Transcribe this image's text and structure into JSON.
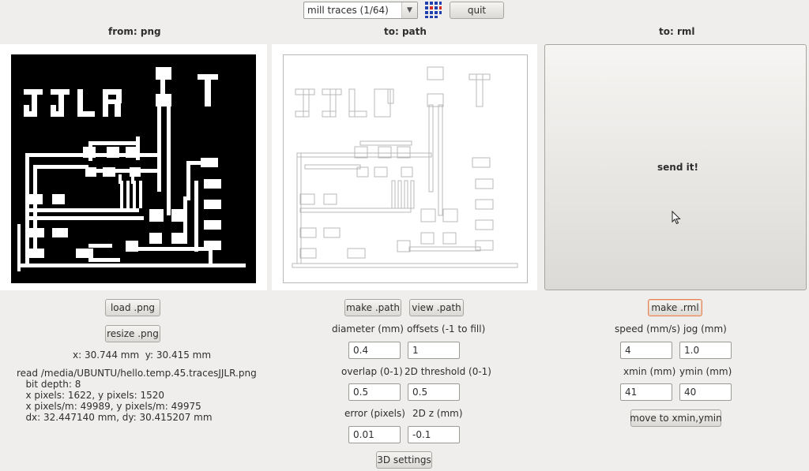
{
  "toolbar": {
    "process_select_value": "mill traces (1/64)",
    "quit_label": "quit",
    "logo_icon": "fab-dots-icon"
  },
  "columns": {
    "from_header": "from: png",
    "to_path_header": "to: path",
    "to_rml_header": "to: rml"
  },
  "png_panel": {
    "load_label": "load .png",
    "resize_label": "resize .png",
    "cursor_readout": "x: 30.744 mm  y: 30.415 mm",
    "info_lines": [
      "read /media/UBUNTU/hello.temp.45.tracesJJLR.png",
      "   bit depth: 8",
      "   x pixels: 1622, y pixels: 1520",
      "   x pixels/m: 49989, y pixels/m: 49975",
      "   dx: 32.447140 mm, dy: 30.415207 mm"
    ],
    "board_text": "JJLR"
  },
  "path_panel": {
    "make_path_label": "make .path",
    "view_path_label": "view .path",
    "diameter_label": "diameter (mm)",
    "diameter_value": "0.4",
    "offsets_label": "offsets (-1 to fill)",
    "offsets_value": "1",
    "overlap_label": "overlap (0-1)",
    "overlap_value": "0.5",
    "threshold_label": "2D threshold (0-1)",
    "threshold_value": "0.5",
    "error_label": "error (pixels)",
    "error_value": "0.01",
    "z_label": "2D z (mm)",
    "z_value": "-0.1",
    "settings_3d_label": "3D settings"
  },
  "rml_panel": {
    "send_label": "send it!",
    "make_rml_label": "make .rml",
    "speed_label": "speed (mm/s)",
    "speed_value": "4",
    "jog_label": "jog (mm)",
    "jog_value": "1.0",
    "xmin_label": "xmin (mm)",
    "xmin_value": "41",
    "ymin_label": "ymin (mm)",
    "ymin_value": "40",
    "move_label": "move to xmin,ymin"
  }
}
